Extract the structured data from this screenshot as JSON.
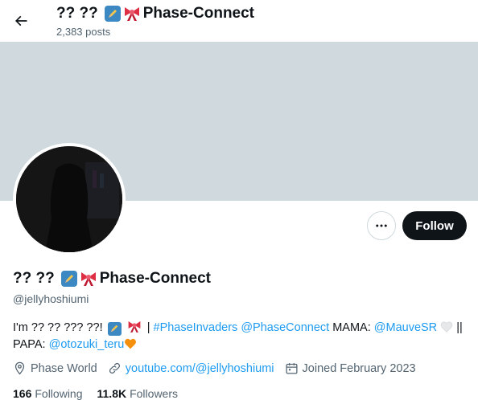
{
  "header": {
    "back_icon": "arrow-left-icon",
    "name_prefix": "?? ??",
    "name_suffix": "Phase-Connect",
    "posts": "2,383 posts"
  },
  "profile": {
    "name_prefix": "?? ??",
    "name_suffix": "Phase-Connect",
    "handle": "@jellyhoshiumi",
    "follow_label": "Follow",
    "more_icon": "more-dots-icon"
  },
  "bio": {
    "intro": "I'm ?? ?? ??? ??!",
    "sep1": " | ",
    "hashtag": "#PhaseInvaders",
    "mention_company": "@PhaseConnect",
    "mama_label": " MAMA: ",
    "mama_handle": "@MauveSR",
    "sep2": " || ",
    "papa_label": "PAPA: ",
    "papa_handle": "@otozuki_teru"
  },
  "meta": {
    "location": "Phase World",
    "website": "youtube.com/@jellyhoshiumi",
    "joined": "Joined February 2023"
  },
  "stats": {
    "following_count": "166",
    "following_label": "Following",
    "followers_count": "11.8K",
    "followers_label": "Followers"
  },
  "colors": {
    "accent": "#1d9bf0",
    "banner": "#cfd9de",
    "button_dark": "#0f1419",
    "secondary_text": "#536471"
  }
}
